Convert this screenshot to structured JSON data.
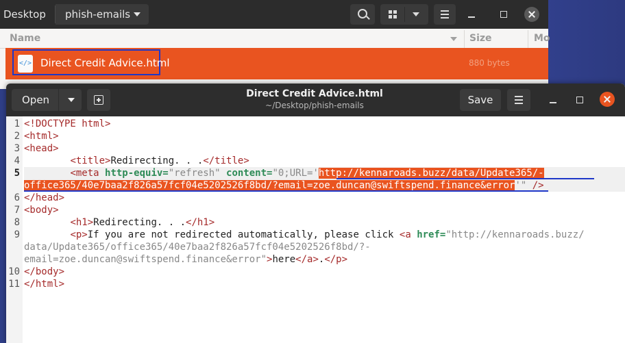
{
  "file_manager": {
    "breadcrumb_root": "Desktop",
    "breadcrumb_current": "phish-emails",
    "columns": {
      "name": "Name",
      "size": "Size",
      "modified": "Mo"
    },
    "file": {
      "icon_text": "</>",
      "name": "Direct Credit Advice.html",
      "size": "880 bytes"
    }
  },
  "editor": {
    "open_label": "Open",
    "save_label": "Save",
    "title": "Direct Credit Advice.html",
    "subtitle": "~/Desktop/phish-emails",
    "line_numbers": [
      "1",
      "2",
      "3",
      "4",
      "5",
      "",
      "6",
      "7",
      "8",
      "9",
      "",
      "",
      "10",
      "11"
    ],
    "code": {
      "l1": "<!DOCTYPE html>",
      "l2": "<html>",
      "l3": "<head>",
      "l4_indent": "        ",
      "l4_open": "<title>",
      "l4_text": "Redirecting. . .",
      "l4_close": "</title>",
      "l5_open": "<meta ",
      "l5_attr1": "http-equiv=",
      "l5_val1": "\"refresh\"",
      "l5_attr2": " content=",
      "l5_val2_pre": "\"0;URL='",
      "l5_url_a": "http://kennaroads.buzz/data/Update365/-",
      "l5_url_b": "office365/40e7baa2f826a57fcf04e5202526f8bd/?email=zoe.duncan@swiftspend.finance&error",
      "l5_val2_post": "'\"",
      "l5_close": " />",
      "l6": "</head>",
      "l7": "<body>",
      "l8_open": "<h1>",
      "l8_text": "Redirecting. . .",
      "l8_close": "</h1>",
      "l9_open": "<p>",
      "l9_text": "If you are not redirected automatically, please click ",
      "l9_a_open": "<a ",
      "l9_attr": "href=",
      "l9_href_a": "\"http://kennaroads.buzz/",
      "l9_href_b": "data/Update365/office365/40e7baa2f826a57fcf04e5202526f8bd/?-",
      "l9_href_c": "email=zoe.duncan@swiftspend.finance&error\"",
      "l9_gt": ">",
      "l9_link_text": "here",
      "l9_a_close": "</a>",
      "l9_dot": ".",
      "l9_p_close": "</p>",
      "l10": "</body>",
      "l11": "</html>"
    }
  },
  "colors": {
    "accent": "#e95420",
    "highlight_border": "#1e37c8",
    "header_dark": "#2d2d2d"
  }
}
